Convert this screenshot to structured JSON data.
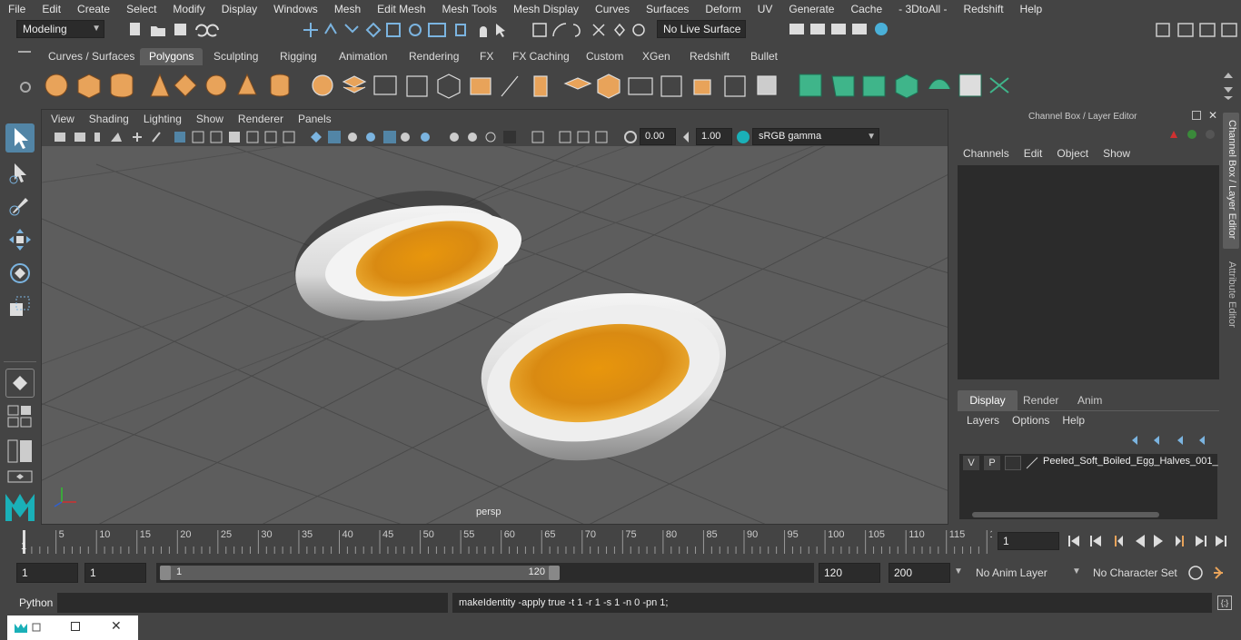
{
  "menubar": [
    "File",
    "Edit",
    "Create",
    "Select",
    "Modify",
    "Display",
    "Windows",
    "Mesh",
    "Edit Mesh",
    "Mesh Tools",
    "Mesh Display",
    "Curves",
    "Surfaces",
    "Deform",
    "UV",
    "Generate",
    "Cache",
    "- 3DtoAll -",
    "Redshift",
    "Help"
  ],
  "status": {
    "mode": "Modeling",
    "live_surface": "No Live Surface"
  },
  "shelf_tabs": [
    "Curves / Surfaces",
    "Polygons",
    "Sculpting",
    "Rigging",
    "Animation",
    "Rendering",
    "FX",
    "FX Caching",
    "Custom",
    "XGen",
    "Redshift",
    "Bullet"
  ],
  "shelf_active": "Polygons",
  "viewport": {
    "menu": [
      "View",
      "Shading",
      "Lighting",
      "Show",
      "Renderer",
      "Panels"
    ],
    "field_value_1": "0.00",
    "field_value_2": "1.00",
    "color_space": "sRGB gamma",
    "camera_label": "persp"
  },
  "channel_box": {
    "title": "Channel Box / Layer Editor",
    "menu": [
      "Channels",
      "Edit",
      "Object",
      "Show"
    ]
  },
  "layer_editor": {
    "tabs": [
      "Display",
      "Render",
      "Anim"
    ],
    "active_tab": "Display",
    "menu": [
      "Layers",
      "Options",
      "Help"
    ],
    "layer": {
      "v": "V",
      "p": "P",
      "name": "Peeled_Soft_Boiled_Egg_Halves_001_"
    }
  },
  "side_tabs": [
    "Channel Box / Layer Editor",
    "Attribute Editor"
  ],
  "timeline": {
    "ticks": [
      "5",
      "10",
      "15",
      "20",
      "25",
      "30",
      "35",
      "40",
      "45",
      "50",
      "55",
      "60",
      "65",
      "70",
      "75",
      "80",
      "85",
      "90",
      "95",
      "100",
      "105",
      "110",
      "115",
      "12"
    ],
    "start_marker": "1",
    "current_frame": "1"
  },
  "range": {
    "start": "1",
    "playback_start": "1",
    "slider_start": "1",
    "slider_end": "120",
    "playback_end": "120",
    "end": "200",
    "anim_layer": "No Anim Layer",
    "character_set": "No Character Set"
  },
  "command": {
    "language": "Python",
    "output": "makeIdentity -apply true -t 1 -r 1 -s 1 -n 0 -pn 1;"
  },
  "colors": {
    "accent": "#5285a6",
    "panel": "#444444",
    "viewport": "#5d5d5d",
    "field": "#2b2b2b"
  }
}
